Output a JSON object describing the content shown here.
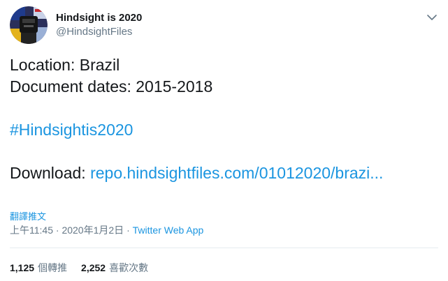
{
  "user": {
    "display_name": "Hindsight is 2020",
    "handle": "@HindsightFiles"
  },
  "tweet": {
    "line1": "Location: Brazil",
    "line2": "Document dates: 2015-2018",
    "hashtag": "#Hindsightis2020",
    "download_label": "Download:",
    "download_link": "repo.hindsightfiles.com/01012020/brazi..."
  },
  "translate_label": "翻譯推文",
  "meta": {
    "time": "上午11:45",
    "date": "2020年1月2日",
    "separator": "·",
    "app": "Twitter Web App"
  },
  "stats": {
    "retweets_count": "1,125",
    "retweets_label": "個轉推",
    "likes_count": "2,252",
    "likes_label": "喜歡次數"
  },
  "colors": {
    "link": "#1b95e0",
    "secondary": "#657786",
    "primary": "#14171a",
    "divider": "#e6ecf0"
  }
}
